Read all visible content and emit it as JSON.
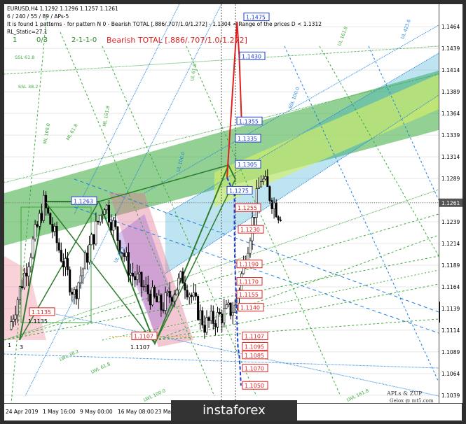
{
  "header": {
    "symbol_line": "EURUSD,H4 1.1292 1.1296 1.1257 1.1261",
    "params_line": "6 / 240 / 55 / 89 / APs-5",
    "pattern_line": "It is found 1 patterns  -  for pattern N 0 - Bearish TOTAL [.886/.707/1.0/1.272] - 1.1304 < Range of the prices D < 1.1312",
    "static_line": "RL_Static=27.1",
    "counter_1": "1",
    "counter_2": "0/3",
    "counter_3": "2-1-1-0",
    "pattern_title": "Bearish TOTAL [.886/.707/1.0/1.272]"
  },
  "chart_data": {
    "type": "line",
    "symbol": "EURUSD",
    "timeframe": "H4",
    "ohlc": {
      "open": 1.1292,
      "high": 1.1296,
      "low": 1.1257,
      "close": 1.1261
    },
    "y_ticks": [
      1.1464,
      1.1439,
      1.1414,
      1.1389,
      1.1364,
      1.1339,
      1.1314,
      1.1289,
      1.1261,
      1.1239,
      1.1214,
      1.1189,
      1.1164,
      1.1139,
      1.1114,
      1.1089,
      1.1064,
      1.1039
    ],
    "current_price": "1.1261",
    "ylim": [
      1.103,
      1.149
    ],
    "x_tick_labels": [
      "24 Apr 2019",
      "1 May 16:00",
      "9 May 00:00",
      "16 May 08:00",
      "23 Ma"
    ],
    "price_levels_blue": [
      "1.1475",
      "1.1430",
      "1.1355",
      "1.1335",
      "1.1305",
      "1.1275",
      "1.1263"
    ],
    "price_levels_red": [
      "1.1255",
      "1.1230",
      "1.1190",
      "1.1170",
      "1.1155",
      "1.1140",
      "1.1107",
      "1.1095",
      "1.1085",
      "1.1070",
      "1.1050",
      "1.1135",
      "1.1107"
    ],
    "series": [
      {
        "name": "projection-up",
        "x": [
          0.915,
          0.92,
          0.925
        ],
        "y": [
          1.147,
          1.143,
          1.136
        ]
      },
      {
        "name": "projection-down",
        "x": [
          0.909,
          0.909,
          0.91,
          0.912,
          0.913,
          0.914,
          0.916,
          0.917,
          0.92,
          0.922,
          0.924
        ],
        "y": [
          1.127,
          1.123,
          1.119,
          1.1165,
          1.115,
          1.1137,
          1.1107,
          1.1095,
          1.1085,
          1.107,
          1.105
        ]
      }
    ],
    "annotations": [
      "LWL 38.2",
      "LWL 61.8",
      "LWL 100.0",
      "LWL 161.8",
      "SSL 61.8",
      "SSL 38.2",
      "ML 61.8",
      "ML 100.0",
      "ML 161.8",
      "UL 61.8",
      "UL 38.2",
      "UL 100.0",
      "UL 423.6",
      "UL 161.8",
      "SSL 100.0"
    ],
    "pivot_labels": [
      "1",
      "3",
      "1.1107",
      "1.1135"
    ]
  },
  "footer": {
    "credit_1": "APLs & ZUP",
    "credit_2": "Gelox @ mt5.com",
    "watermark": "instaforex"
  }
}
